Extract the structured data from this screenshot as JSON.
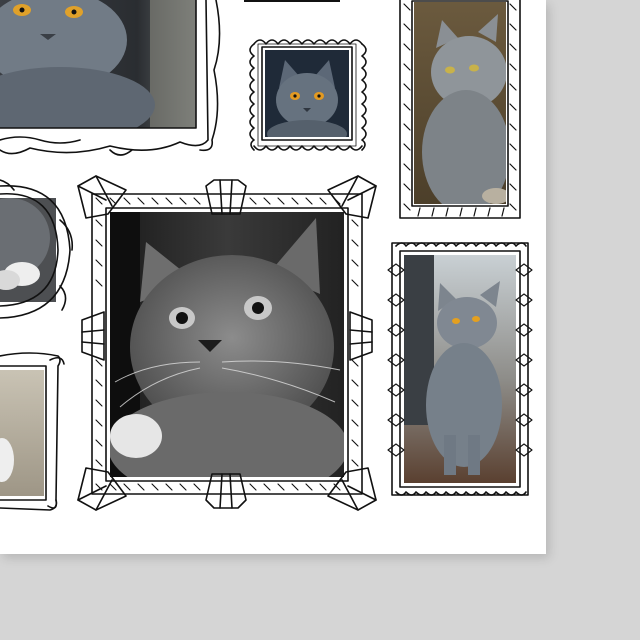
{
  "colors": {
    "background": "#d5d5d5",
    "paper": "#ffffff",
    "ink": "#111111",
    "cat_blue_gray": "#6f7a86",
    "cat_dark": "#3a4048",
    "eye_amber": "#d99a2b"
  },
  "photos": [
    {
      "name": "cat-photo-large-top-left",
      "tone": "color",
      "pose": "lying"
    },
    {
      "name": "cat-photo-small-scalloped",
      "tone": "color",
      "pose": "face"
    },
    {
      "name": "cat-photo-tall-top-right",
      "tone": "color",
      "pose": "profile"
    },
    {
      "name": "cat-photo-oval-left",
      "tone": "color",
      "pose": "paw"
    },
    {
      "name": "cat-photo-center-bw",
      "tone": "bw",
      "pose": "closeup"
    },
    {
      "name": "cat-photo-right-sitting",
      "tone": "color",
      "pose": "sitting"
    },
    {
      "name": "cat-photo-bottom-left",
      "tone": "color",
      "pose": "partial"
    }
  ]
}
